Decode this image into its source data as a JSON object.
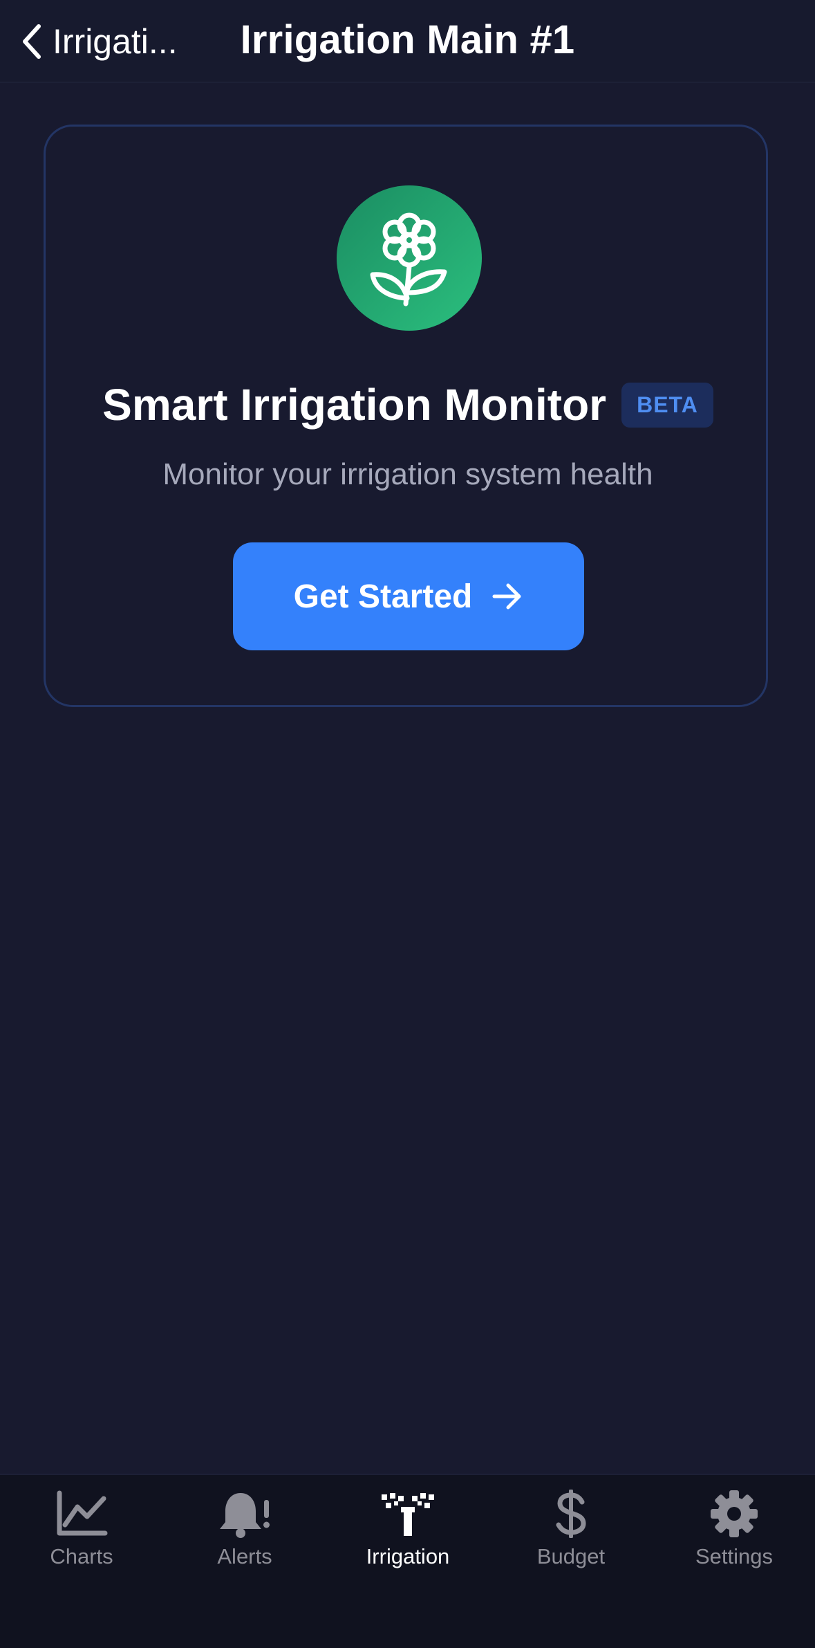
{
  "header": {
    "back_label": "Irrigati...",
    "title": "Irrigation Main #1"
  },
  "card": {
    "icon": "flower-icon",
    "heading": "Smart Irrigation Monitor",
    "badge": "BETA",
    "subtitle": "Monitor your irrigation system health",
    "cta_label": "Get Started"
  },
  "tabs": [
    {
      "label": "Charts",
      "icon": "chart-line-icon",
      "active": false
    },
    {
      "label": "Alerts",
      "icon": "bell-alert-icon",
      "active": false
    },
    {
      "label": "Irrigation",
      "icon": "sprinkler-icon",
      "active": true
    },
    {
      "label": "Budget",
      "icon": "dollar-icon",
      "active": false
    },
    {
      "label": "Settings",
      "icon": "gear-icon",
      "active": false
    }
  ],
  "colors": {
    "background": "#181a2f",
    "accent": "#3481fb",
    "badge_text": "#4f8ef2",
    "icon_gradient_start": "#1b8d62",
    "icon_gradient_end": "#2bbf7e",
    "inactive_tab": "#8e8e97"
  }
}
